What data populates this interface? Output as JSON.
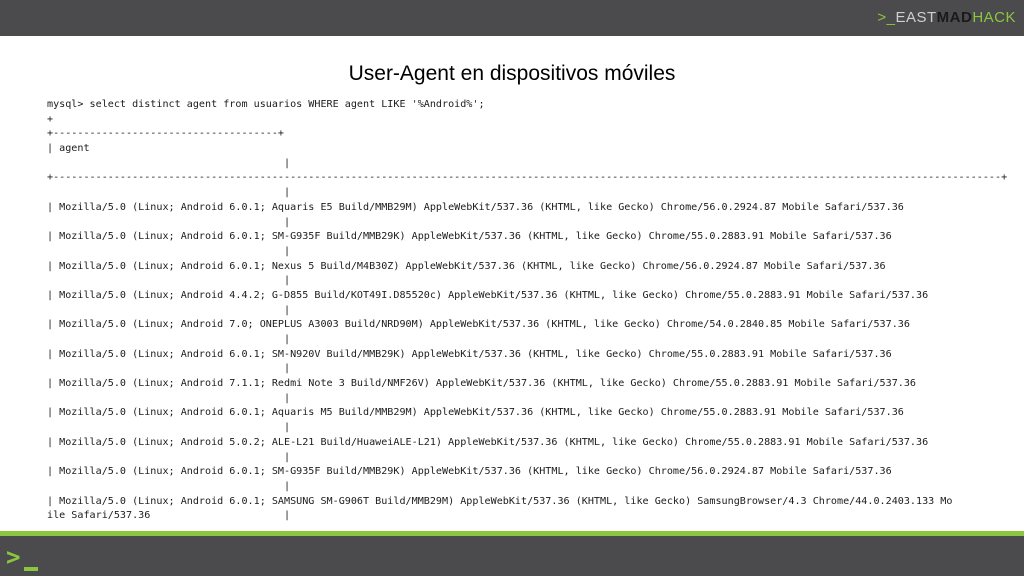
{
  "header": {
    "logo": {
      "prefix": ">_",
      "east": "EAST",
      "mad": "MAD",
      "hack": "HACK"
    }
  },
  "slide": {
    "title": "User-Agent en dispositivos móviles"
  },
  "terminal": {
    "lines": [
      "mysql> select distinct agent from usuarios WHERE agent LIKE '%Android%';",
      "+",
      "+-------------------------------------+",
      "| agent",
      "                                       |",
      "+------------------------------------------------------------------------------------------------------------------------------------------------------------+",
      "                                       |",
      "| Mozilla/5.0 (Linux; Android 6.0.1; Aquaris E5 Build/MMB29M) AppleWebKit/537.36 (KHTML, like Gecko) Chrome/56.0.2924.87 Mobile Safari/537.36",
      "                                       |",
      "| Mozilla/5.0 (Linux; Android 6.0.1; SM-G935F Build/MMB29K) AppleWebKit/537.36 (KHTML, like Gecko) Chrome/55.0.2883.91 Mobile Safari/537.36",
      "                                       |",
      "| Mozilla/5.0 (Linux; Android 6.0.1; Nexus 5 Build/M4B30Z) AppleWebKit/537.36 (KHTML, like Gecko) Chrome/56.0.2924.87 Mobile Safari/537.36",
      "                                       |",
      "| Mozilla/5.0 (Linux; Android 4.4.2; G-D855 Build/KOT49I.D85520c) AppleWebKit/537.36 (KHTML, like Gecko) Chrome/55.0.2883.91 Mobile Safari/537.36",
      "                                       |",
      "| Mozilla/5.0 (Linux; Android 7.0; ONEPLUS A3003 Build/NRD90M) AppleWebKit/537.36 (KHTML, like Gecko) Chrome/54.0.2840.85 Mobile Safari/537.36",
      "                                       |",
      "| Mozilla/5.0 (Linux; Android 6.0.1; SM-N920V Build/MMB29K) AppleWebKit/537.36 (KHTML, like Gecko) Chrome/55.0.2883.91 Mobile Safari/537.36",
      "                                       |",
      "| Mozilla/5.0 (Linux; Android 7.1.1; Redmi Note 3 Build/NMF26V) AppleWebKit/537.36 (KHTML, like Gecko) Chrome/55.0.2883.91 Mobile Safari/537.36",
      "                                       |",
      "| Mozilla/5.0 (Linux; Android 6.0.1; Aquaris M5 Build/MMB29M) AppleWebKit/537.36 (KHTML, like Gecko) Chrome/55.0.2883.91 Mobile Safari/537.36",
      "                                       |",
      "| Mozilla/5.0 (Linux; Android 5.0.2; ALE-L21 Build/HuaweiALE-L21) AppleWebKit/537.36 (KHTML, like Gecko) Chrome/55.0.2883.91 Mobile Safari/537.36",
      "                                       |",
      "| Mozilla/5.0 (Linux; Android 6.0.1; SM-G935F Build/MMB29K) AppleWebKit/537.36 (KHTML, like Gecko) Chrome/56.0.2924.87 Mobile Safari/537.36",
      "                                       |",
      "| Mozilla/5.0 (Linux; Android 6.0.1; SAMSUNG SM-G906T Build/MMB29M) AppleWebKit/537.36 (KHTML, like Gecko) SamsungBrowser/4.3 Chrome/44.0.2403.133 Mo",
      "ile Safari/537.36                      |"
    ]
  },
  "footer": {
    "prompt": ">"
  },
  "colors": {
    "accent_green": "#8cc63e",
    "bar_gray": "#4b4b4d",
    "terminal_text": "#1c1c1c"
  }
}
